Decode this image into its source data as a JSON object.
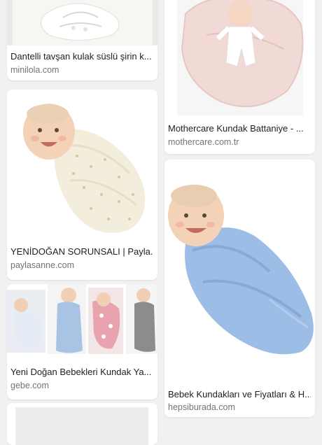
{
  "results": [
    {
      "title": "Dantelli tavşan kulak süslü şirin k...",
      "source": "minilola.com",
      "image_icon": "white-lace-bunny-ear-swaddle-image"
    },
    {
      "title": "Mothercare Kundak Battaniye - ...",
      "source": "mothercare.com.tr",
      "image_icon": "pink-swaddle-blanket-image"
    },
    {
      "title": "YENİDOĞAN SORUNSALI | Payla...",
      "source": "paylasanne.com",
      "image_icon": "cream-star-swaddle-baby-image"
    },
    {
      "title": "Bebek Kundakları ve Fiyatları & H...",
      "source": "hepsiburada.com",
      "image_icon": "blue-swaddle-baby-image"
    },
    {
      "title": "Yeni Doğan Bebekleri Kundak Ya...",
      "source": "gebe.com",
      "image_icon": "swaddle-collage-image"
    }
  ],
  "colors": {
    "background": "#f1f1f1",
    "card": "#ffffff",
    "title_text": "#202124",
    "source_text": "#70757a",
    "blue_swaddle": "#9cbde6",
    "cream_swaddle": "#f3eedb",
    "pink_blanket": "#f1d9d6"
  }
}
